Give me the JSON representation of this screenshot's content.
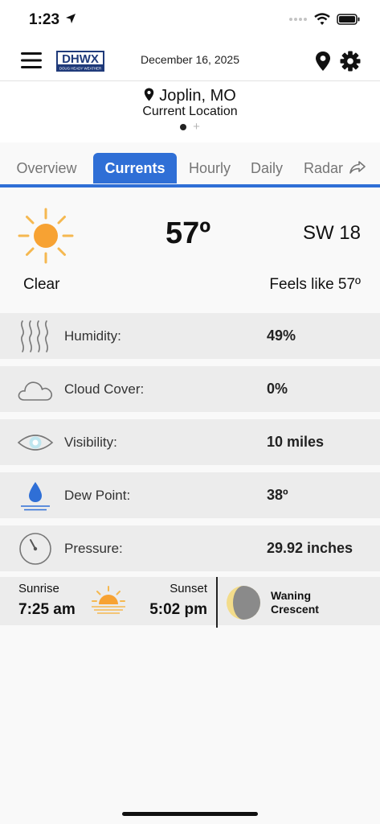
{
  "status_bar": {
    "time": "1:23",
    "icons": [
      "location-arrow-icon",
      "signal-icon",
      "wifi-icon",
      "battery-icon"
    ]
  },
  "header": {
    "menu_icon": "hamburger-icon",
    "logo_text": "DHWX",
    "logo_subtext": "DOUG HEADY WEATHER",
    "date": "December 16, 2025",
    "location_icon": "map-pin-icon",
    "settings_icon": "gear-icon"
  },
  "location": {
    "name": "Joplin, MO",
    "subtitle": "Current Location",
    "pages": [
      "current",
      "add"
    ]
  },
  "tabs": [
    {
      "label": "Overview",
      "active": false
    },
    {
      "label": "Currents",
      "active": true
    },
    {
      "label": "Hourly",
      "active": false
    },
    {
      "label": "Daily",
      "active": false
    },
    {
      "label": "Radar",
      "active": false,
      "icon": "share-icon"
    }
  ],
  "current": {
    "icon": "sun-icon",
    "temperature": "57º",
    "wind": "SW 18",
    "condition": "Clear",
    "feels_like": "Feels like 57º"
  },
  "metrics": [
    {
      "icon": "humidity-icon",
      "label": "Humidity:",
      "value": "49%"
    },
    {
      "icon": "cloud-icon",
      "label": "Cloud Cover:",
      "value": "0%"
    },
    {
      "icon": "eye-icon",
      "label": "Visibility:",
      "value": "10 miles"
    },
    {
      "icon": "water-drop-icon",
      "label": "Dew Point:",
      "value": "38º"
    },
    {
      "icon": "pressure-gauge-icon",
      "label": "Pressure:",
      "value": "29.92 inches"
    }
  ],
  "astro": {
    "sunrise_label": "Sunrise",
    "sunrise_time": "7:25 am",
    "sunset_label": "Sunset",
    "sunset_time": "5:02 pm",
    "sun_icon": "sunset-horizon-icon",
    "moon_icon": "moon-phase-icon",
    "moon_phase_line1": "Waning",
    "moon_phase_line2": "Crescent"
  },
  "colors": {
    "accent": "#2f6fd6",
    "sun": "#f7a233",
    "sun_rays": "#f5b850",
    "row_background": "#ececec",
    "dew_drop": "#2f6fd6",
    "moon_light": "#f3dc8a",
    "moon_dark": "#8a8a8a"
  }
}
